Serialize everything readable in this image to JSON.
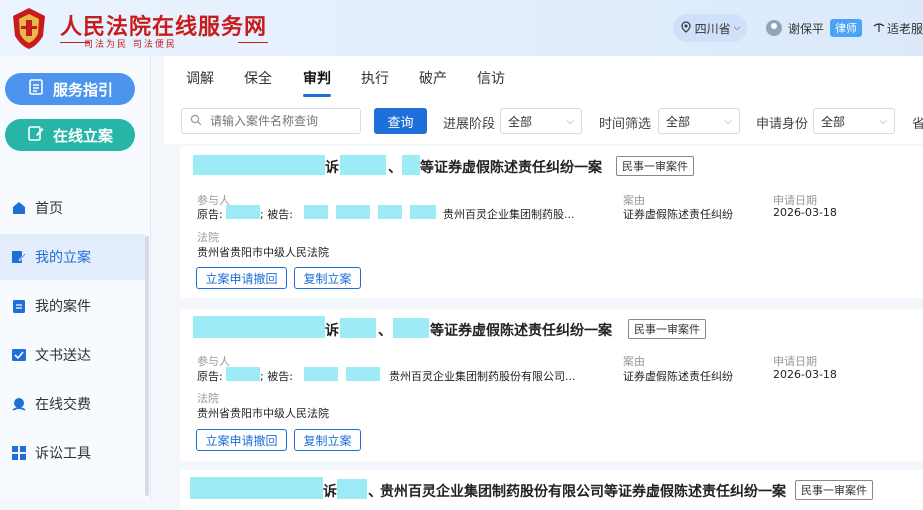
{
  "header": {
    "site_title": "人民法院在线服务网",
    "motto": "司法为民  司法便民",
    "region": "四川省",
    "user_name": "谢保平",
    "user_role": "律师",
    "elder_mode": "适老服"
  },
  "sidebar": {
    "guide_label": "服务指引",
    "online_filing_label": "在线立案",
    "items": [
      {
        "label": "首页",
        "icon": "home-icon"
      },
      {
        "label": "我的立案",
        "icon": "edit-icon"
      },
      {
        "label": "我的案件",
        "icon": "clipboard-icon"
      },
      {
        "label": "文书送达",
        "icon": "check-icon"
      },
      {
        "label": "在线交费",
        "icon": "pay-icon"
      },
      {
        "label": "诉讼工具",
        "icon": "tools-icon"
      }
    ]
  },
  "tabs": [
    "调解",
    "保全",
    "审判",
    "执行",
    "破产",
    "信访"
  ],
  "active_tab": "审判",
  "filters": {
    "search_placeholder": "请输入案件名称查询",
    "query_label": "查询",
    "stage_label": "进展阶段",
    "stage_value": "全部",
    "time_label": "时间筛选",
    "time_value": "全部",
    "identity_label": "申请身份",
    "identity_value": "全部",
    "cut_label": "省"
  },
  "cards": [
    {
      "title_a": "诉",
      "title_b": "、",
      "title_c": "等证券虚假陈述责任纠纷一案",
      "tag": "民事一审案件",
      "party_label": "参与人",
      "party_prefix": "原告:",
      "defendant_prefix": "; 被告:",
      "party_company": "贵州百灵企业集团制药股...",
      "cause_label": "案由",
      "cause_value": "证券虚假陈述责任纠纷",
      "date_label": "申请日期",
      "date_value": "2026-03-18",
      "court_label": "法院",
      "court_value": "贵州省贵阳市中级人民法院",
      "btn_withdraw": "立案申请撤回",
      "btn_copy": "复制立案"
    },
    {
      "title_a": "诉",
      "title_b": "、",
      "title_c": "等证券虚假陈述责任纠纷一案",
      "tag": "民事一审案件",
      "party_label": "参与人",
      "party_prefix": "原告:",
      "defendant_prefix": "; 被告:",
      "party_company": "贵州百灵企业集团制药股份有限公司...",
      "cause_label": "案由",
      "cause_value": "证券虚假陈述责任纠纷",
      "date_label": "申请日期",
      "date_value": "2026-03-18",
      "court_label": "法院",
      "court_value": "贵州省贵阳市中级人民法院",
      "btn_withdraw": "立案申请撤回",
      "btn_copy": "复制立案"
    },
    {
      "title_a": "诉",
      "title_b": "、",
      "title_c": "贵州百灵企业集团制药股份有限公司等证券虚假陈述责任纠纷一案",
      "tag": "民事一审案件"
    }
  ],
  "colors": {
    "primary": "#1e6fd9",
    "brand_red": "#c71c1c",
    "redaction": "#29d3ef"
  }
}
